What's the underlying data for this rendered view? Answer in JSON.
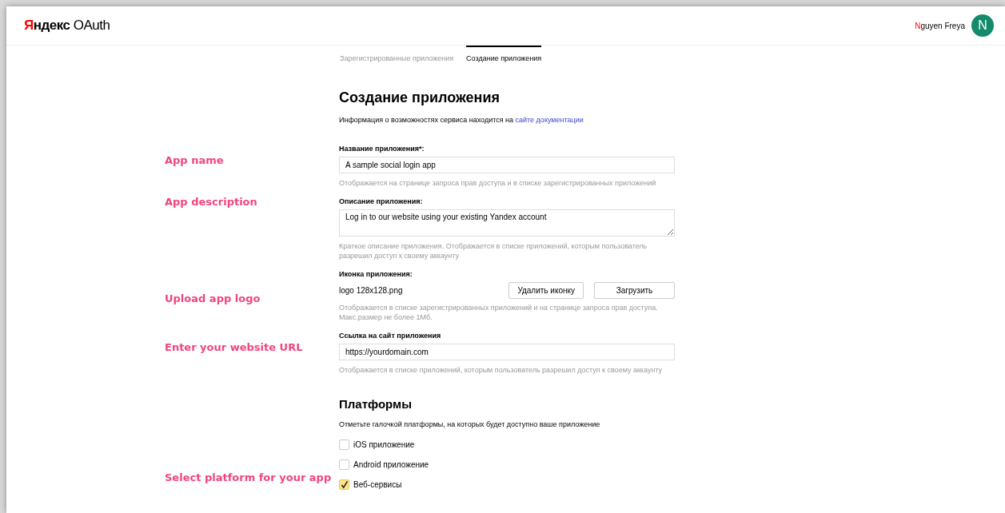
{
  "header": {
    "logo": {
      "initial": "Я",
      "rest": "ндекс",
      "product": "OAuth"
    },
    "user": {
      "initial": "N",
      "rest": "guyen Freya",
      "avatar_letter": "N"
    }
  },
  "tabs": [
    {
      "label": "Зарегистрированные приложения",
      "selected": false
    },
    {
      "label": "Создание приложения",
      "selected": true
    }
  ],
  "title": "Создание приложения",
  "intro": {
    "text": "Информация о возможностях сервиса находится на",
    "link": "сайте документации"
  },
  "fields": [
    {
      "kind": "input",
      "annotation": "App name",
      "label": "Название приложения*:",
      "value": "A sample social login app",
      "hint": "Отображается на странице запроса прав доступа и в списке зарегистрированных приложений"
    },
    {
      "kind": "textarea",
      "annotation": "App description",
      "label": "Описание приложения:",
      "value": "Log in to our website using your existing Yandex account",
      "hint": "Краткое описание приложения. Отображается в списке приложений, которым пользователь разрешил доступ к своему аккаунту"
    },
    {
      "kind": "file",
      "annotation": "Upload app logo",
      "label": "Иконка приложения:",
      "value": "logo 128x128.png",
      "buttons": [
        "Удалить иконку",
        "Загрузить"
      ],
      "hint": "Отображается в списке зарегистрированных приложений и на странице запроса прав доступа. Макс.размер не более 1Мб."
    },
    {
      "kind": "input",
      "annotation": "Enter your website URL",
      "label": "Ссылка на сайт приложения",
      "value": "https://yourdomain.com",
      "hint": "Отображается в списке приложений, которым пользователь разрешил доступ к своему аккаунту"
    }
  ],
  "platforms": {
    "title": "Платформы",
    "description": "Отметьте галочкой платформы, на которых будет доступно ваше приложение",
    "annotation": "Select platform for your app",
    "options": [
      {
        "label": "iOS приложение",
        "checked": false
      },
      {
        "label": "Android приложение",
        "checked": false
      },
      {
        "label": "Веб-сервисы",
        "checked": true
      }
    ]
  }
}
